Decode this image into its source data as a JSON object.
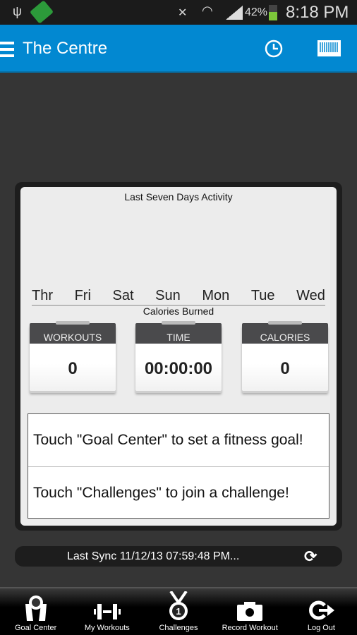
{
  "status_bar": {
    "battery": "42%",
    "time": "8:18 PM"
  },
  "app_bar": {
    "title": "The Centre",
    "icons": [
      "menu-icon",
      "clock-icon",
      "barcode-icon"
    ]
  },
  "chart": {
    "title": "Last Seven Days Activity",
    "days": [
      "Thr",
      "Fri",
      "Sat",
      "Sun",
      "Mon",
      "Tue",
      "Wed"
    ],
    "y_label": "Calories Burned"
  },
  "stats": [
    {
      "label": "WORKOUTS",
      "value": "0"
    },
    {
      "label": "TIME",
      "value": "00:00:00"
    },
    {
      "label": "CALORIES",
      "value": "0"
    }
  ],
  "messages": [
    "Touch \"Goal Center\" to set a fitness goal!",
    "Touch \"Challenges\" to join a challenge!"
  ],
  "sync": {
    "text": "Last Sync 11/12/13 07:59:48 PM..."
  },
  "nav": [
    {
      "label": "Goal Center"
    },
    {
      "label": "My Workouts"
    },
    {
      "label": "Challenges"
    },
    {
      "label": "Record Workout"
    },
    {
      "label": "Log Out"
    }
  ],
  "colors": {
    "accent": "#0288d1"
  }
}
